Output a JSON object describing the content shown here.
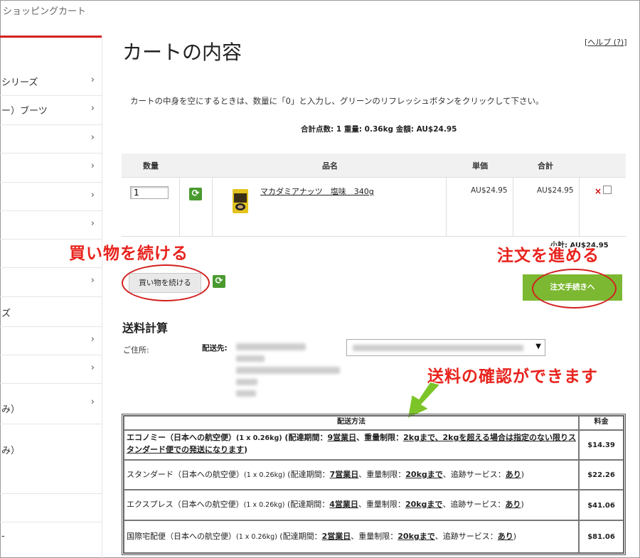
{
  "breadcrumb": "ショッピングカート",
  "sidebar": {
    "items": [
      {
        "label": "シリーズ",
        "chev": "›"
      },
      {
        "label": "ー）ブーツ",
        "chev": "›"
      },
      {
        "label": "",
        "chev": "›"
      },
      {
        "label": "",
        "chev": "›"
      },
      {
        "label": "",
        "chev": "›"
      },
      {
        "label": "",
        "chev": "›"
      },
      {
        "label": "",
        "chev": ""
      },
      {
        "label": "",
        "chev": "›"
      },
      {
        "label": "ズ",
        "chev": ""
      },
      {
        "label": "",
        "chev": "›"
      },
      {
        "label": "",
        "chev": "›"
      },
      {
        "label": "み）",
        "chev": "›"
      },
      {
        "label": "み）",
        "chev": ""
      },
      {
        "label": "",
        "chev": ""
      },
      {
        "label": "-",
        "chev": ""
      }
    ]
  },
  "page": {
    "title": "カートの内容",
    "help_open": "[",
    "help_link": "ヘルプ (?)",
    "help_close": "]",
    "instructions": "カートの中身を空にするときは、数量に「0」と入力し、グリーンのリフレッシュボタンをクリックして下さい。",
    "summary": "合計点数: 1  重量: 0.36kg  金額: AU$24.95"
  },
  "cart": {
    "headers": {
      "qty": "数量",
      "name": "品名",
      "unit": "単価",
      "total": "合計"
    },
    "item": {
      "qty": "1",
      "name": "マカダミアナッツ　塩味　340g",
      "unit_price": "AU$24.95",
      "total": "AU$24.95",
      "delete": "×"
    },
    "subtotal": "小計: AU$24.95"
  },
  "buttons": {
    "continue": "買い物を続ける",
    "checkout": "注文手続きへ"
  },
  "annotations": {
    "continue": "買い物を続ける",
    "checkout": "注文を進める",
    "shipping": "送料の確認ができます"
  },
  "shipping": {
    "title": "送料計算",
    "address_label": "ご住所:",
    "dest_label": "配送先:",
    "headers": {
      "method": "配送方法",
      "fee": "料金"
    },
    "options": [
      {
        "name": "エコノミー（日本への航空便）",
        "weight": "(1 x 0.26kg)",
        "p1": " (配達期間：",
        "days": "9営業日",
        "p2": "、重量制限：",
        "limit": "2kgまで、2kgを超える場合は指定のない限りスタンダード便での発送になります",
        "p3": ")",
        "fee": "$14.39"
      },
      {
        "name": "スタンダード（日本への航空便）",
        "weight": "(1 x 0.26kg)",
        "p1": " (配達期間：",
        "days": "7営業日",
        "p2": "、重量制限：",
        "limit": "20kgまで",
        "p3": "、追跡サービス：",
        "track": "あり",
        "p4": ")",
        "fee": "$22.26"
      },
      {
        "name": "エクスプレス（日本への航空便）",
        "weight": "(1 x 0.26kg)",
        "p1": " (配達期間：",
        "days": "4営業日",
        "p2": "、重量制限：",
        "limit": "20kgまで",
        "p3": "、追跡サービス：",
        "track": "あり",
        "p4": ")",
        "fee": "$41.06"
      },
      {
        "name": "国際宅配便（日本への航空便）",
        "weight": "(1 x 0.26kg)",
        "p1": " (配達期間：",
        "days": "2営業日",
        "p2": "、重量制限：",
        "limit": "20kgまで",
        "p3": "、追跡サービス：",
        "track": "あり",
        "p4": ")",
        "fee": "$81.06"
      }
    ]
  },
  "colors": {
    "accent_red": "#d32020",
    "checkout_green": "#7cb832",
    "refresh_green": "#4a9a30",
    "annotation_red": "#e8231d"
  }
}
